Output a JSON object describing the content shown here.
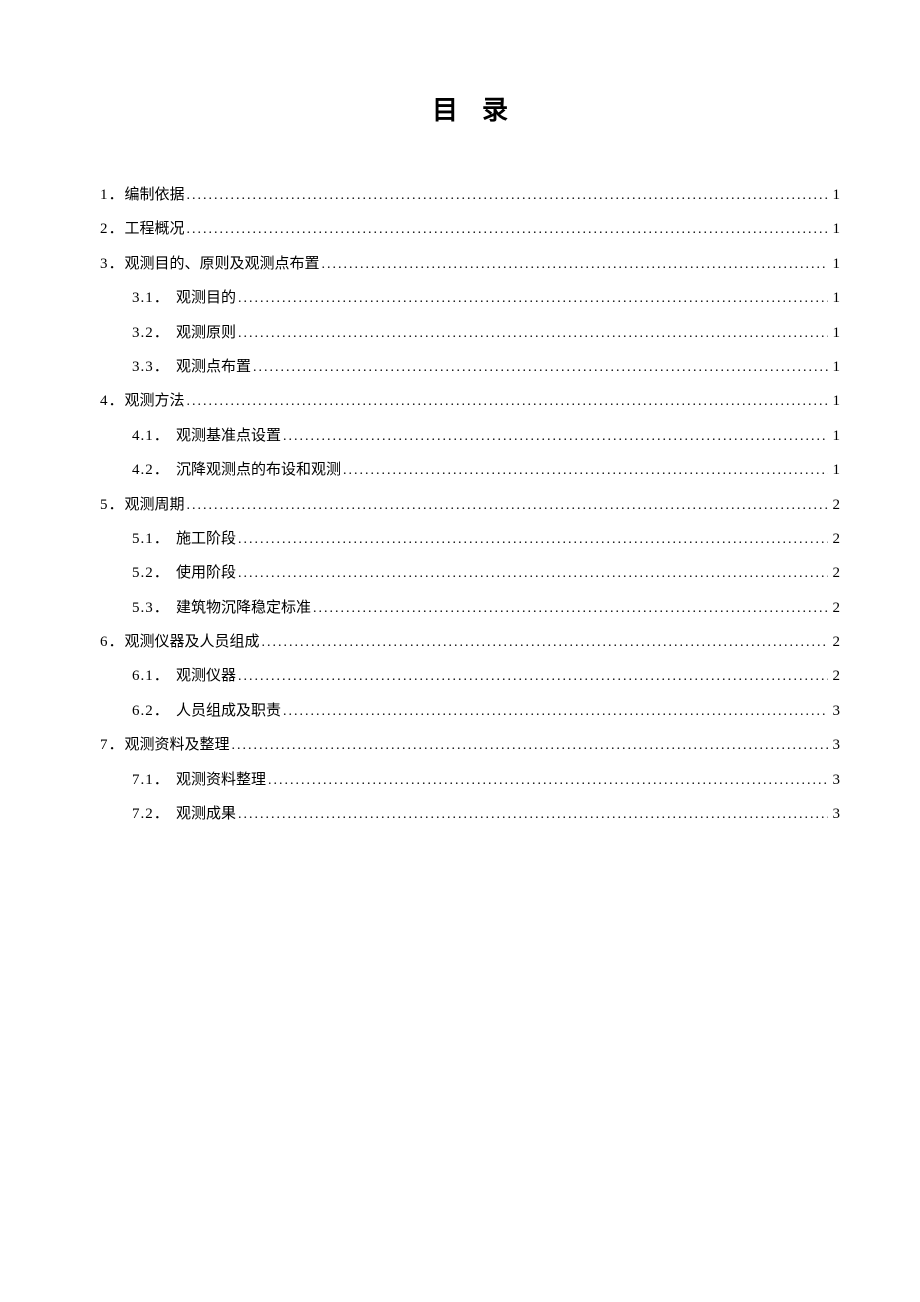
{
  "title": "目录",
  "toc": [
    {
      "level": 1,
      "num": "1．",
      "label": "编制依据",
      "page": "1"
    },
    {
      "level": 1,
      "num": "2．",
      "label": "工程概况",
      "page": "1"
    },
    {
      "level": 1,
      "num": "3．",
      "label": "观测目的、原则及观测点布置",
      "page": "1"
    },
    {
      "level": 2,
      "num": "3.1．",
      "label": "观测目的",
      "page": "1"
    },
    {
      "level": 2,
      "num": "3.2．",
      "label": "观测原则",
      "page": "1"
    },
    {
      "level": 2,
      "num": "3.3．",
      "label": "观测点布置",
      "page": "1"
    },
    {
      "level": 1,
      "num": "4．",
      "label": "观测方法",
      "page": "1"
    },
    {
      "level": 2,
      "num": "4.1．",
      "label": "观测基准点设置",
      "page": "1"
    },
    {
      "level": 2,
      "num": "4.2．",
      "label": "沉降观测点的布设和观测",
      "page": "1"
    },
    {
      "level": 1,
      "num": "5．",
      "label": "观测周期",
      "page": "2"
    },
    {
      "level": 2,
      "num": "5.1．",
      "label": "施工阶段",
      "page": "2"
    },
    {
      "level": 2,
      "num": "5.2．",
      "label": "使用阶段",
      "page": "2"
    },
    {
      "level": 2,
      "num": "5.3．",
      "label": "建筑物沉降稳定标准",
      "page": "2"
    },
    {
      "level": 1,
      "num": "6．",
      "label": "观测仪器及人员组成",
      "page": "2"
    },
    {
      "level": 2,
      "num": "6.1．",
      "label": "观测仪器",
      "page": "2"
    },
    {
      "level": 2,
      "num": "6.2．",
      "label": "人员组成及职责",
      "page": "3"
    },
    {
      "level": 1,
      "num": "7．",
      "label": "观测资料及整理",
      "page": "3"
    },
    {
      "level": 2,
      "num": "7.1．",
      "label": "观测资料整理",
      "page": "3"
    },
    {
      "level": 2,
      "num": "7.2．",
      "label": "观测成果",
      "page": "3"
    }
  ]
}
